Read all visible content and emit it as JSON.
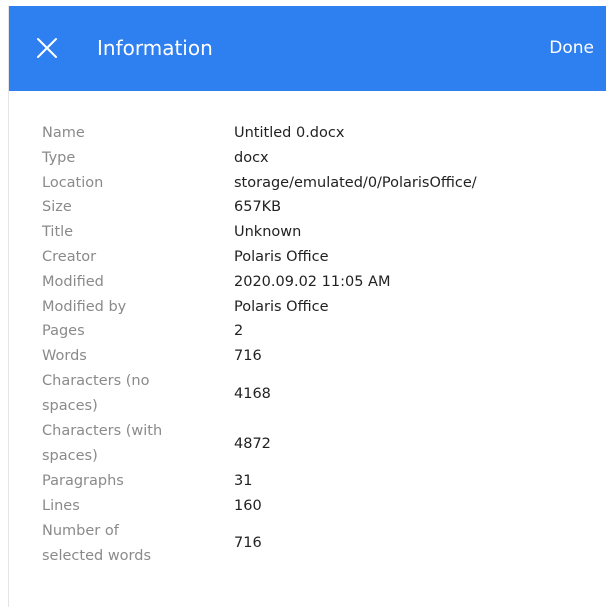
{
  "header": {
    "title": "Information",
    "done_label": "Done",
    "close_icon": "close-icon",
    "background_color": "#2e7ff0"
  },
  "info": {
    "rows": [
      {
        "label": "Name",
        "value": "Untitled 0.docx"
      },
      {
        "label": "Type",
        "value": "docx"
      },
      {
        "label": "Location",
        "value": "storage/emulated/0/PolarisOffice/"
      },
      {
        "label": "Size",
        "value": "657KB"
      },
      {
        "label": "Title",
        "value": "Unknown"
      },
      {
        "label": "Creator",
        "value": "Polaris Office"
      },
      {
        "label": "Modified",
        "value": "2020.09.02 11:05 AM"
      },
      {
        "label": "Modified by",
        "value": "Polaris Office"
      },
      {
        "label": "Pages",
        "value": "2"
      },
      {
        "label": "Words",
        "value": "716"
      },
      {
        "label": "Characters (no spaces)",
        "value": "4168"
      },
      {
        "label": "Characters (with spaces)",
        "value": "4872"
      },
      {
        "label": "Paragraphs",
        "value": "31"
      },
      {
        "label": "Lines",
        "value": "160"
      },
      {
        "label": "Number of selected words",
        "value": "716"
      }
    ]
  }
}
